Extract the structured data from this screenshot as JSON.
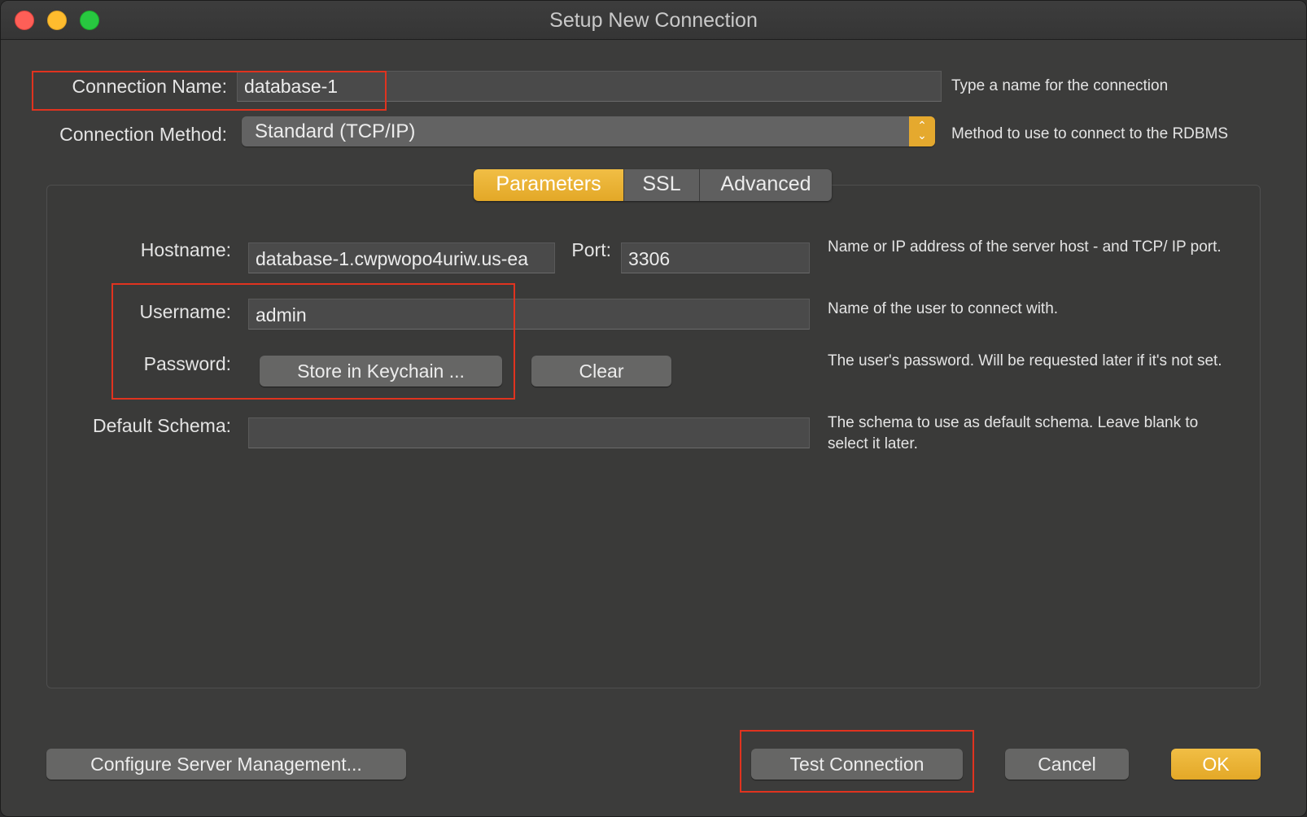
{
  "window": {
    "title": "Setup New Connection"
  },
  "connection_name": {
    "label": "Connection Name:",
    "value": "database-1",
    "hint": "Type a name for the connection"
  },
  "connection_method": {
    "label": "Connection Method:",
    "value": "Standard (TCP/IP)",
    "hint": "Method to use to connect to the RDBMS"
  },
  "tabs": [
    {
      "label": "Parameters",
      "active": true
    },
    {
      "label": "SSL",
      "active": false
    },
    {
      "label": "Advanced",
      "active": false
    }
  ],
  "params": {
    "hostname_label": "Hostname:",
    "hostname_value": "database-1.cwpwopo4uriw.us-ea",
    "port_label": "Port:",
    "port_value": "3306",
    "host_hint": "Name or IP address of the server host - and TCP/ IP port.",
    "username_label": "Username:",
    "username_value": "admin",
    "username_hint": "Name of the user to connect with.",
    "password_label": "Password:",
    "store_keychain_label": "Store in Keychain ...",
    "clear_label": "Clear",
    "password_hint": "The user's password. Will be requested later if it's not set.",
    "schema_label": "Default Schema:",
    "schema_value": "",
    "schema_hint": "The schema to use as default schema. Leave blank to select it later."
  },
  "footer": {
    "configure_label": "Configure Server Management...",
    "test_label": "Test Connection",
    "cancel_label": "Cancel",
    "ok_label": "OK"
  },
  "colors": {
    "accent": "#e5a92e",
    "annotation": "#e0331f",
    "window_bg": "#3c3c3b"
  }
}
